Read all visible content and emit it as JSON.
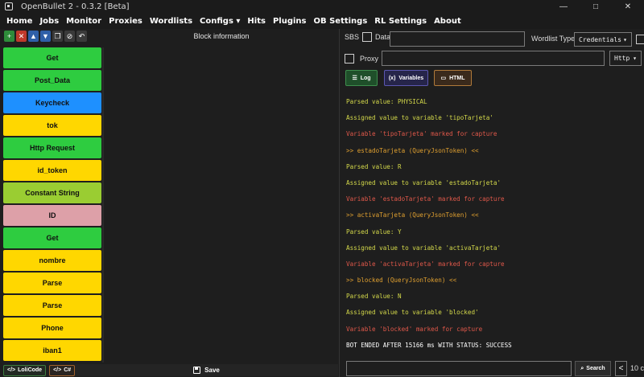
{
  "window": {
    "title": "OpenBullet 2 - 0.3.2 [Beta]",
    "controls": [
      "—",
      "□",
      "✕"
    ]
  },
  "menu": [
    {
      "label": "Home"
    },
    {
      "label": "Jobs"
    },
    {
      "label": "Monitor"
    },
    {
      "label": "Proxies"
    },
    {
      "label": "Wordlists"
    },
    {
      "label": "Configs ▾"
    },
    {
      "label": "Hits"
    },
    {
      "label": "Plugins"
    },
    {
      "label": "OB Settings"
    },
    {
      "label": "RL Settings"
    },
    {
      "label": "About"
    }
  ],
  "toolbar": {
    "buttons": [
      {
        "icon": "plus-icon",
        "glyph": "+",
        "color": "green"
      },
      {
        "icon": "close-icon",
        "glyph": "✕",
        "color": "red"
      },
      {
        "icon": "chevron-up-icon",
        "glyph": "▲",
        "color": "blue"
      },
      {
        "icon": "chevron-down-icon",
        "glyph": "▼",
        "color": "blue"
      },
      {
        "icon": "copy-icon",
        "glyph": "❐",
        "color": "grey"
      },
      {
        "icon": "disable-icon",
        "glyph": "⊘",
        "color": "grey"
      },
      {
        "icon": "undo-icon",
        "glyph": "↶",
        "color": "grey"
      }
    ]
  },
  "block_panel": {
    "title": "Block information"
  },
  "blocks": [
    {
      "label": "Get",
      "color": "#2ecc40"
    },
    {
      "label": "Post_Data",
      "color": "#2ecc40"
    },
    {
      "label": "Keycheck",
      "color": "#1e90ff"
    },
    {
      "label": "tok",
      "color": "#ffd700"
    },
    {
      "label": "Http Request",
      "color": "#2ecc40"
    },
    {
      "label": "id_token",
      "color": "#ffd700"
    },
    {
      "label": "Constant String",
      "color": "#9acd32"
    },
    {
      "label": "ID",
      "color": "#dda0a8"
    },
    {
      "label": "Get",
      "color": "#2ecc40"
    },
    {
      "label": "nombre",
      "color": "#ffd700"
    },
    {
      "label": "Parse",
      "color": "#ffd700"
    },
    {
      "label": "Parse",
      "color": "#ffd700"
    },
    {
      "label": "Phone",
      "color": "#ffd700"
    },
    {
      "label": "iban1",
      "color": "#ffd700"
    }
  ],
  "bottom_left": {
    "loli_label": "LoliCode",
    "csharp_label": "C#",
    "save_label": "Save"
  },
  "debugger": {
    "sbs_label": "SBS",
    "data_label": "Data",
    "data_value": "",
    "wordlist_type_label": "Wordlist Type",
    "wordlist_type_value": "Credentials",
    "proxy_label": "Proxy",
    "proxy_value": "",
    "proxy_type_value": "Http",
    "tabs": {
      "log": "Log",
      "variables": "Variables",
      "html": "HTML"
    }
  },
  "log": [
    {
      "text": "Parsed value: PHYSICAL",
      "color": "#d4d94a"
    },
    {
      "text": "Assigned value to variable 'tipoTarjeta'",
      "color": "#d4d94a"
    },
    {
      "text": "Variable 'tipoTarjeta' marked for capture",
      "color": "#e0584a"
    },
    {
      "text": ">> estadoTarjeta (QueryJsonToken) <<",
      "color": "#e0a030"
    },
    {
      "text": "Parsed value: R",
      "color": "#d4d94a"
    },
    {
      "text": "Assigned value to variable 'estadoTarjeta'",
      "color": "#d4d94a"
    },
    {
      "text": "Variable 'estadoTarjeta' marked for capture",
      "color": "#e0584a"
    },
    {
      "text": ">> activaTarjeta (QueryJsonToken) <<",
      "color": "#e0a030"
    },
    {
      "text": "Parsed value: Y",
      "color": "#d4d94a"
    },
    {
      "text": "Assigned value to variable 'activaTarjeta'",
      "color": "#d4d94a"
    },
    {
      "text": "Variable 'activaTarjeta' marked for capture",
      "color": "#e0584a"
    },
    {
      "text": ">> blocked (QueryJsonToken) <<",
      "color": "#e0a030"
    },
    {
      "text": "Parsed value: N",
      "color": "#d4d94a"
    },
    {
      "text": "Assigned value to variable 'blocked'",
      "color": "#d4d94a"
    },
    {
      "text": "Variable 'blocked' marked for capture",
      "color": "#e0584a"
    },
    {
      "text": "BOT ENDED AFTER 15166 ms WITH STATUS: SUCCESS",
      "color": "#ffffff"
    }
  ],
  "search": {
    "value": "",
    "button_label": "Search",
    "prev_glyph": "<",
    "count": "10 c"
  }
}
